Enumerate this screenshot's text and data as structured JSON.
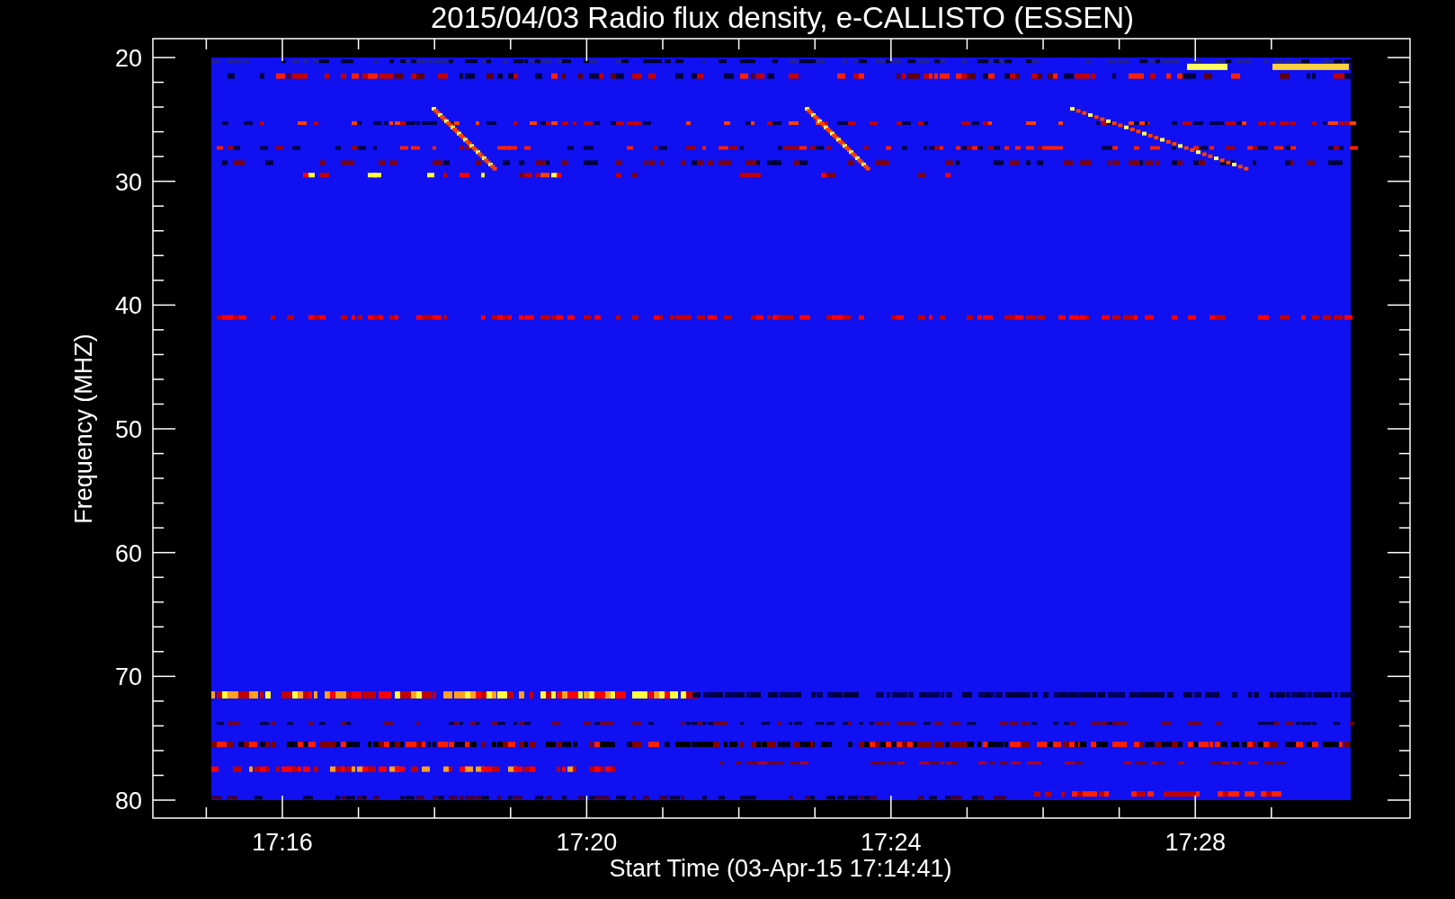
{
  "title": "2015/04/03  Radio flux density, e-CALLISTO (ESSEN)",
  "plot": {
    "ylabel": "Frequency (MHZ)",
    "xlabel": "Start Time (03-Apr-15 17:14:41)",
    "yticks": [
      "20",
      "30",
      "40",
      "50",
      "60",
      "70",
      "80"
    ],
    "xticks": [
      "17:16",
      "17:20",
      "17:24",
      "17:28"
    ]
  }
}
